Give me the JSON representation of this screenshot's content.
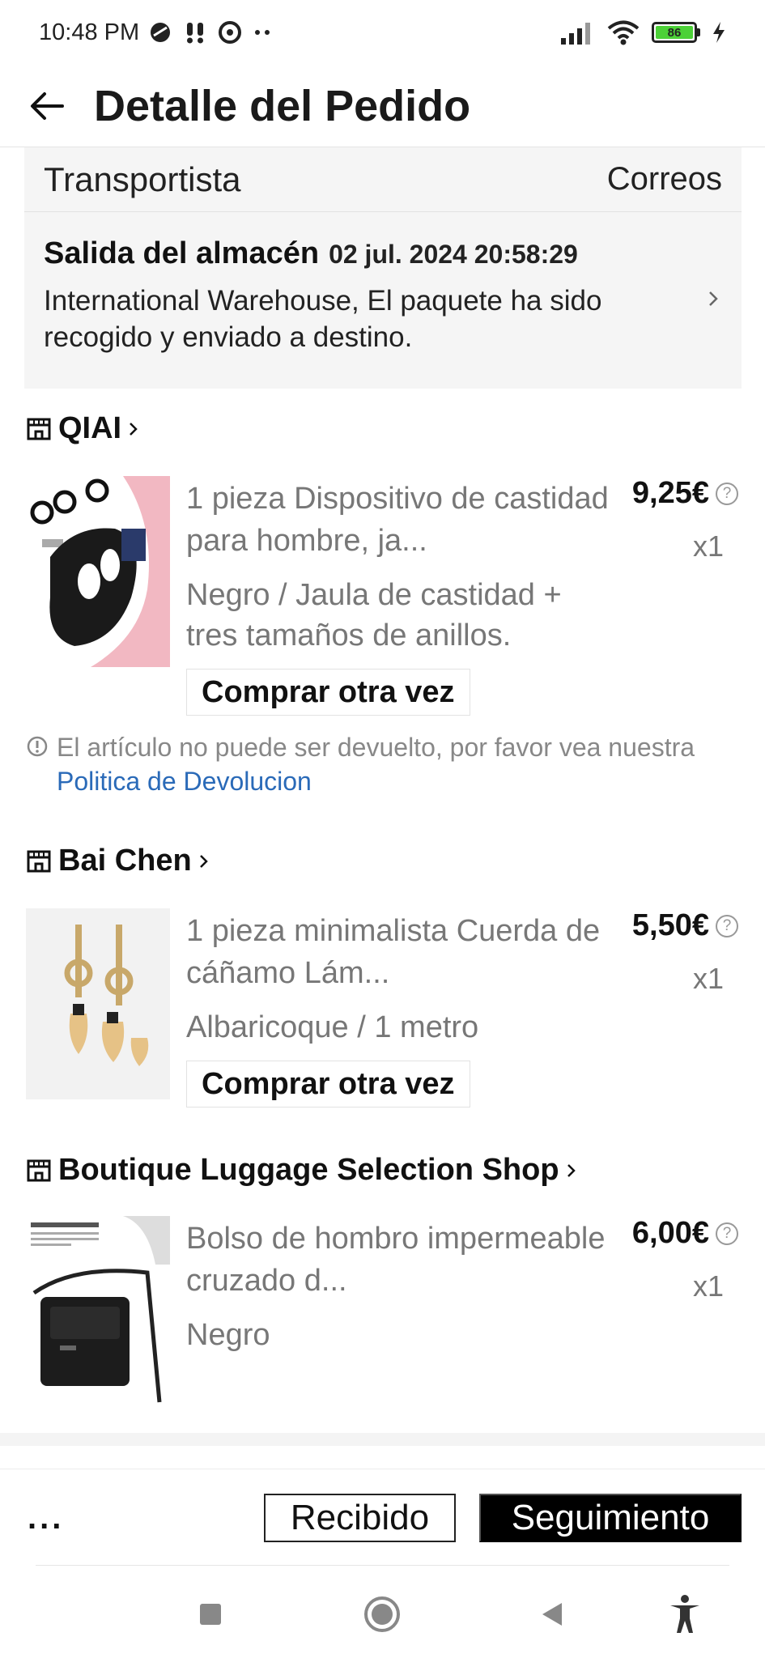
{
  "status_bar": {
    "time": "10:48 PM",
    "battery": "86"
  },
  "header": {
    "title": "Detalle del Pedido"
  },
  "tracking": {
    "carrier_label": "Transportista",
    "carrier_value": "Correos",
    "event_title": "Salida del almacén",
    "event_time": "02 jul. 2024 20:58:29",
    "event_description": "International Warehouse, El paquete ha sido recogido y enviado a destino."
  },
  "shops": [
    {
      "name": "QIAI",
      "product": {
        "title": "1 pieza Dispositivo de castidad para hombre, ja...",
        "variant": "Negro / Jaula de castidad + tres tamaños de anillos.",
        "price": "9,25€",
        "quantity": "x1",
        "buy_again": "Comprar otra vez"
      }
    },
    {
      "name": "Bai Chen",
      "product": {
        "title": "1 pieza minimalista Cuerda de cáñamo Lám...",
        "variant": "Albaricoque / 1 metro",
        "price": "5,50€",
        "quantity": "x1",
        "buy_again": "Comprar otra vez"
      }
    },
    {
      "name": "Boutique Luggage Selection Shop",
      "product": {
        "title": "Bolso de hombro impermeable cruzado d...",
        "variant": "Negro",
        "price": "6,00€",
        "quantity": "x1"
      }
    }
  ],
  "return_note": {
    "text": "El artículo no puede ser devuelto, por favor vea nuestra",
    "link": "Politica de Devolucion"
  },
  "bottom_bar": {
    "more": "...",
    "received": "Recibido",
    "tracking": "Seguimiento"
  },
  "colors": {
    "link": "#2a6ab8",
    "card_bg": "#f5f5f5",
    "primary_button": "#000000",
    "battery": "#4cd137"
  }
}
